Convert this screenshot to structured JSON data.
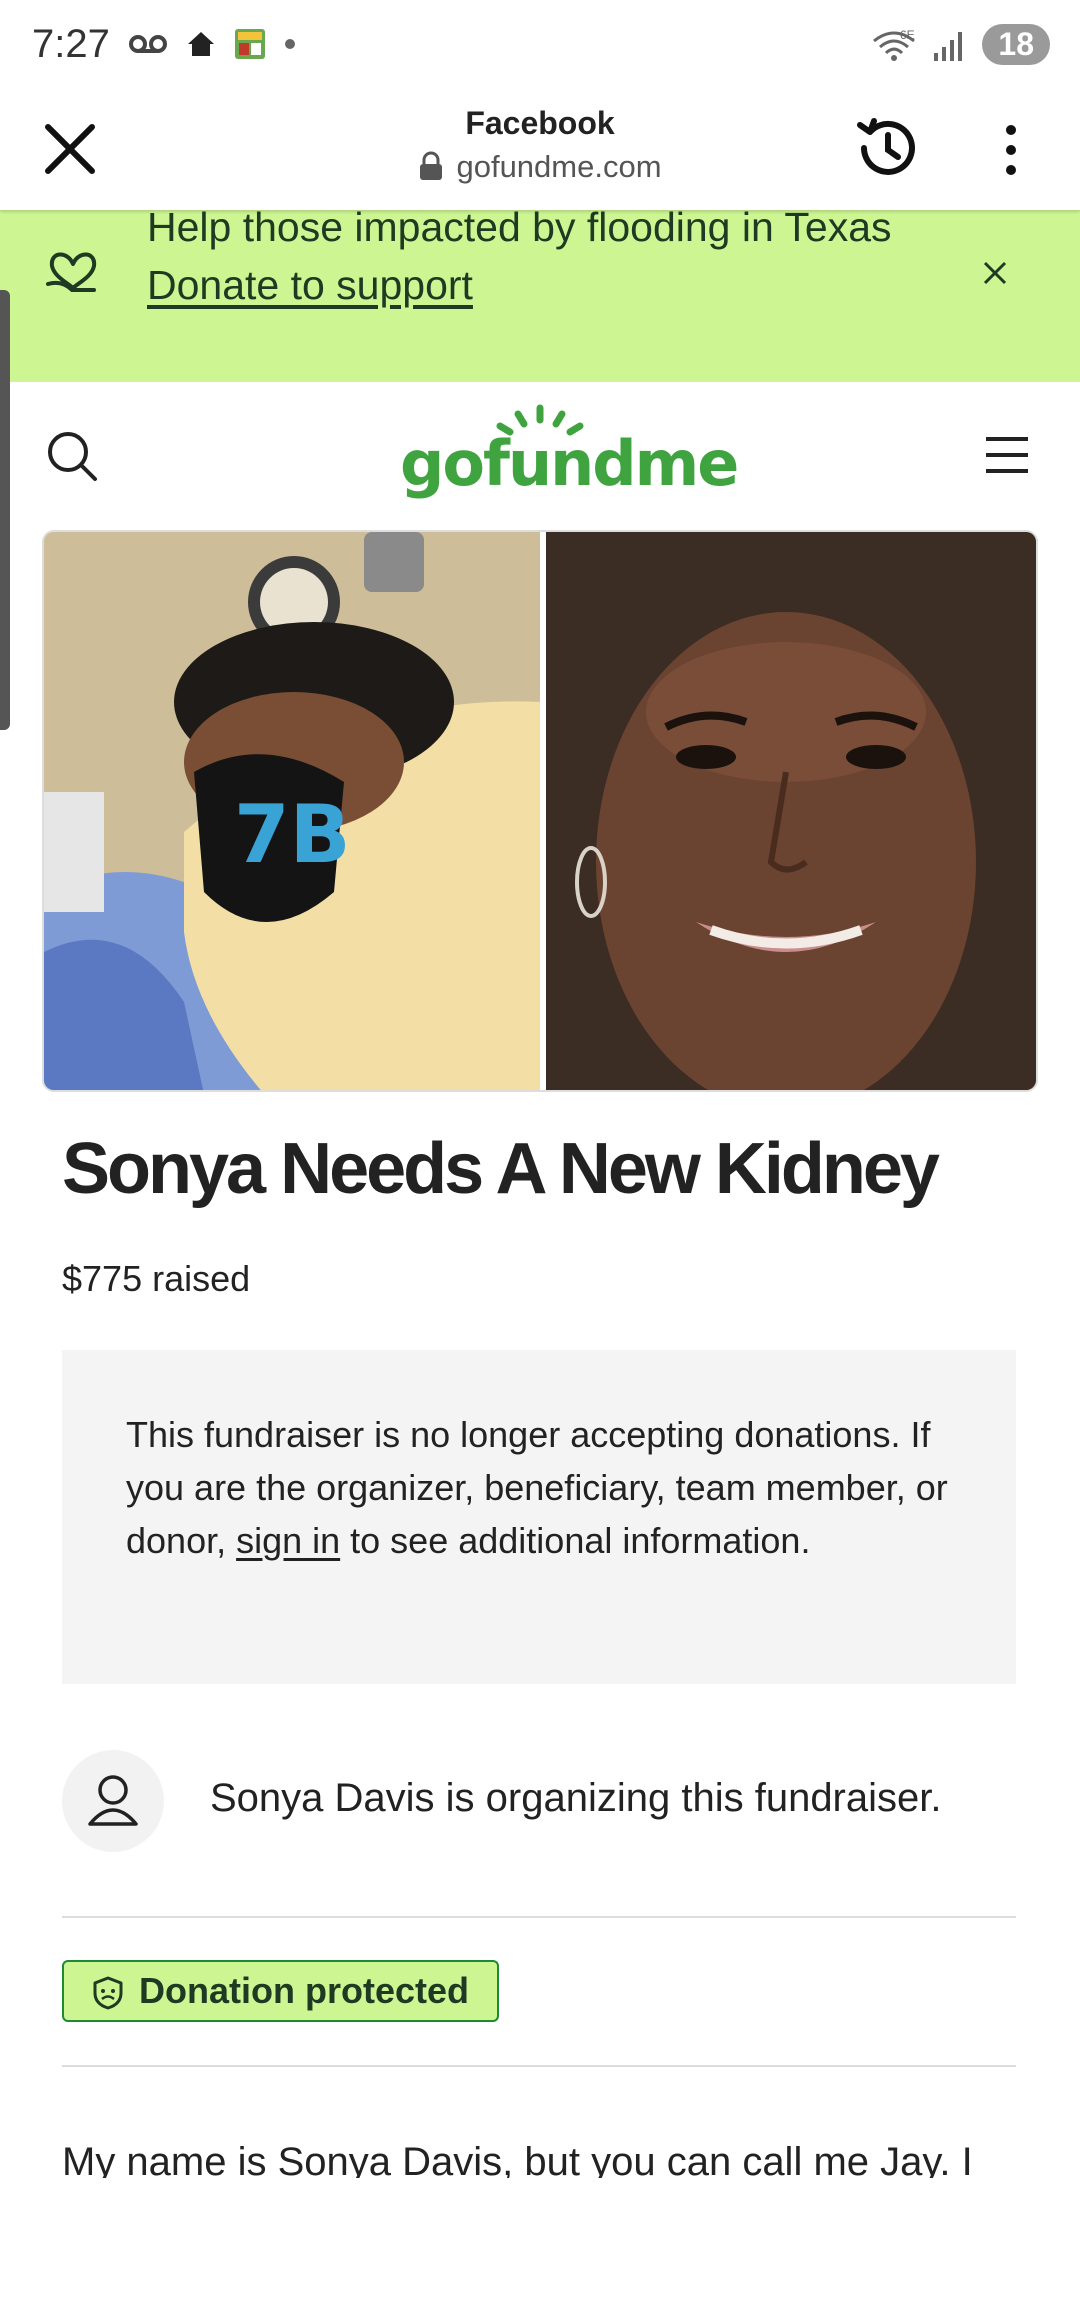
{
  "status_bar": {
    "time": "7:27",
    "battery": "18",
    "network": "6E"
  },
  "browser": {
    "title": "Facebook",
    "url": "gofundme.com"
  },
  "banner": {
    "text": "Help those impacted by flooding in Texas",
    "link": "Donate to support"
  },
  "site": {
    "logo": "gofundme"
  },
  "campaign": {
    "title": "Sonya Needs A New Kidney",
    "raised": "$775 raised",
    "notice_part1": "This fundraiser is no longer accepting donations. If you are the organizer, beneficiary, team member, or donor, ",
    "notice_link": "sign in",
    "notice_part2": " to see additional information.",
    "organizer": "Sonya Davis is organizing this fundraiser.",
    "protected_label": "Donation protected",
    "story_start": "My name is Sonya Davis, but you can call me Jay. I"
  },
  "colors": {
    "banner_bg": "#cdf592",
    "brand_green": "#3fa43f",
    "badge_border": "#1e8a34"
  }
}
